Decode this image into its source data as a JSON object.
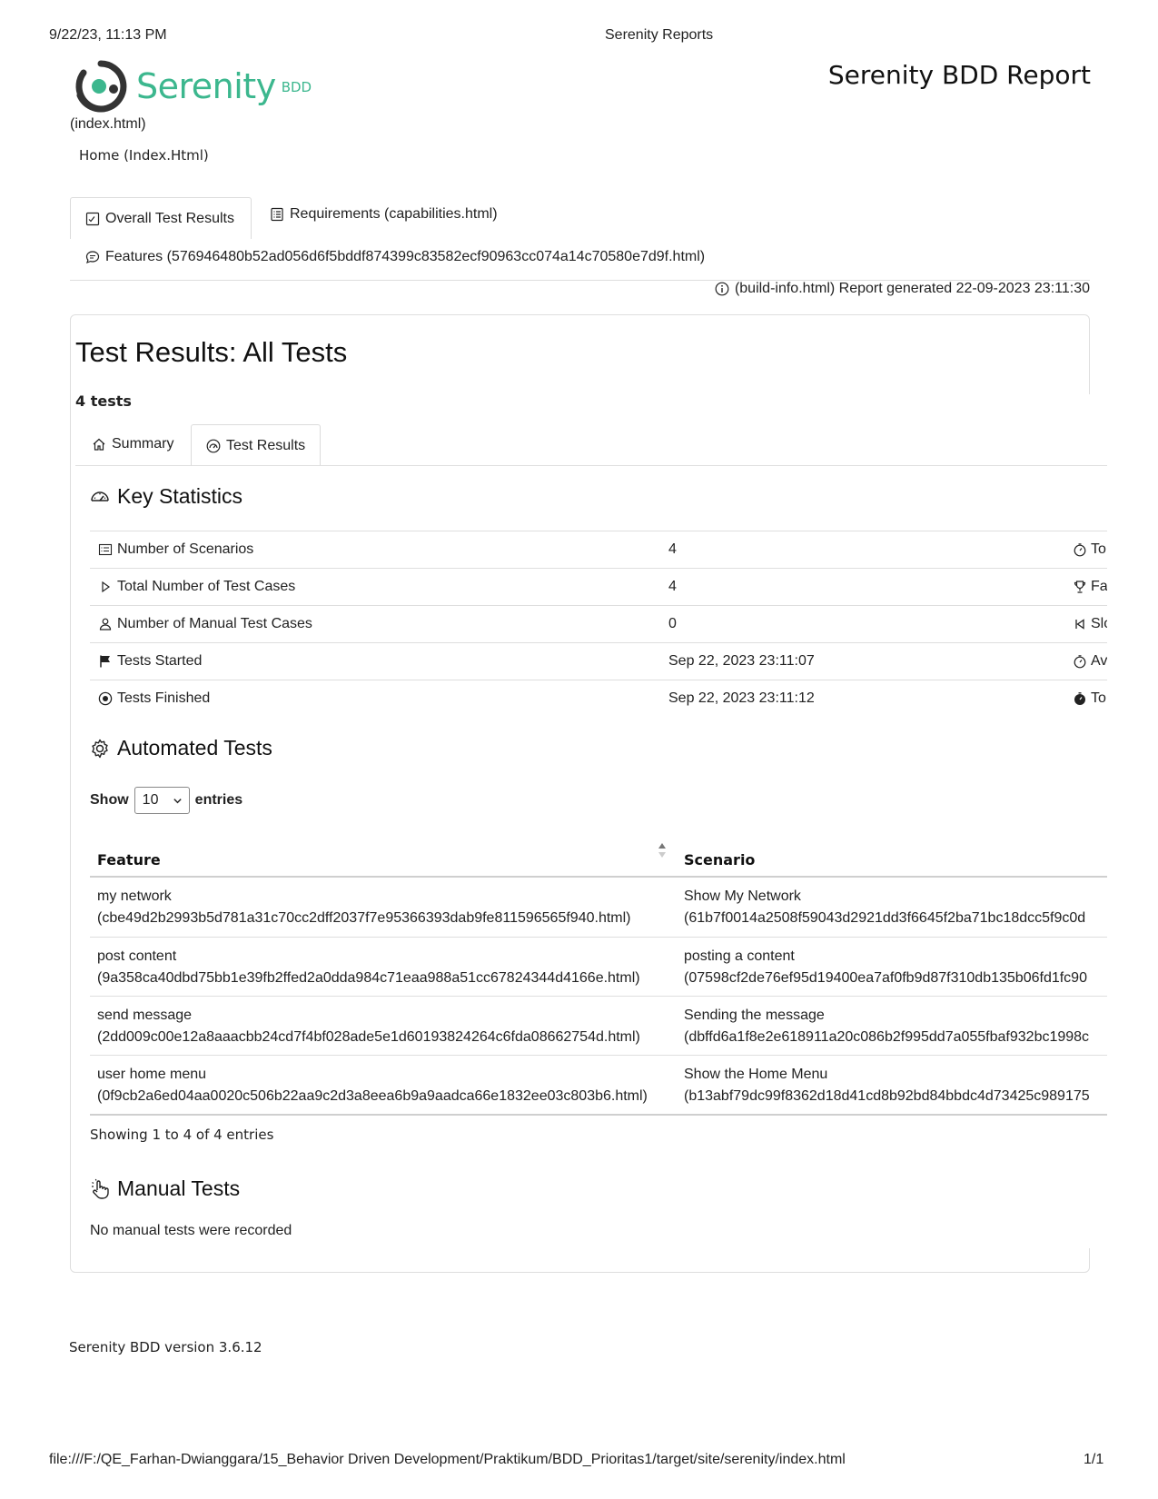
{
  "print_header": {
    "datetime": "9/22/23, 11:13 PM",
    "page_title": "Serenity Reports"
  },
  "logo": {
    "name": "Serenity",
    "suffix": "BDD"
  },
  "report_title": "Serenity BDD Report",
  "index_link": "(index.html)",
  "breadcrumb": "Home (Index.Html)",
  "main_tabs": [
    {
      "label": "Overall Test Results",
      "icon": "checklist-icon",
      "active": true
    },
    {
      "label": "Requirements (capabilities.html)",
      "icon": "list-icon",
      "active": false
    },
    {
      "label": "Features (576946480b52ad056d6f5bddf874399c83582ecf90963cc074a14c70580e7d9f.html)",
      "icon": "chat-icon",
      "active": false
    }
  ],
  "report_generated": "(build-info.html) Report generated 22-09-2023 23:11:30",
  "card": {
    "title": "Test Results: All Tests",
    "test_count": "4 tests",
    "tabs": [
      {
        "label": "Summary",
        "icon": "home-icon",
        "active": false
      },
      {
        "label": "Test Results",
        "icon": "dashboard-icon",
        "active": true
      }
    ]
  },
  "key_statistics": {
    "heading": "Key Statistics",
    "rows": [
      {
        "label": "Number of Scenarios",
        "value": "4",
        "side": "To",
        "icon": "list-icon",
        "side_icon": "stopwatch-icon"
      },
      {
        "label": "Total Number of Test Cases",
        "value": "4",
        "side": "Fa",
        "icon": "play-icon",
        "side_icon": "trophy-icon"
      },
      {
        "label": "Number of Manual Test Cases",
        "value": "0",
        "side": "Slo",
        "icon": "person-icon",
        "side_icon": "skip-back-icon"
      },
      {
        "label": "Tests Started",
        "value": "Sep 22, 2023 23:11:07",
        "side": "Av",
        "icon": "flag-icon",
        "side_icon": "stopwatch-icon"
      },
      {
        "label": "Tests Finished",
        "value": "Sep 22, 2023 23:11:12",
        "side": "To",
        "icon": "stop-circle-icon",
        "side_icon": "stopwatch-filled-icon"
      }
    ]
  },
  "automated_tests": {
    "heading": "Automated Tests",
    "show_label": "Show",
    "page_size": "10",
    "entries_label": "entries",
    "columns": [
      "Feature",
      "Scenario"
    ],
    "rows": [
      {
        "feature": "my network",
        "feature_link": "(cbe49d2b2993b5d781a31c70cc2dff2037f7e95366393dab9fe811596565f940.html)",
        "scenario": "Show My Network",
        "scenario_link": "(61b7f0014a2508f59043d2921dd3f6645f2ba71bc18dcc5f9c0d"
      },
      {
        "feature": "post content",
        "feature_link": "(9a358ca40dbd75bb1e39fb2ffed2a0dda984c71eaa988a51cc67824344d4166e.html)",
        "scenario": "posting a content",
        "scenario_link": "(07598cf2de76ef95d19400ea7af0fb9d87f310db135b06fd1fc90"
      },
      {
        "feature": "send message",
        "feature_link": "(2dd009c00e12a8aaacbb24cd7f4bf028ade5e1d60193824264c6fda08662754d.html)",
        "scenario": "Sending the message",
        "scenario_link": "(dbffd6a1f8e2e618911a20c086b2f995dd7a055fbaf932bc1998c"
      },
      {
        "feature": "user home menu",
        "feature_link": "(0f9cb2a6ed04aa0020c506b22aa9c2d3a8eea6b9a9aadca66e1832ee03c803b6.html)",
        "scenario": "Show the Home Menu",
        "scenario_link": "(b13abf79dc99f8362d18d41cd8b92bd84bbdc4d73425c989175"
      }
    ],
    "info": "Showing 1 to 4 of 4 entries"
  },
  "manual_tests": {
    "heading": "Manual Tests",
    "message": "No manual tests were recorded"
  },
  "footer": "Serenity BDD version 3.6.12",
  "print_footer": {
    "url": "file:///F:/QE_Farhan-Dwianggara/15_Behavior Driven Development/Praktikum/BDD_Prioritas1/target/site/serenity/index.html",
    "page": "1/1"
  },
  "colors": {
    "brand": "#3cb78e",
    "logo_dark": "#333333",
    "border": "#dedede"
  }
}
